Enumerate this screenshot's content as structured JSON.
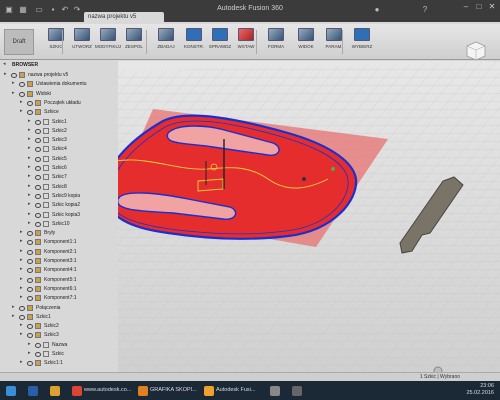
{
  "app": {
    "title": "Autodesk Fusion 360"
  },
  "doc_tab": {
    "label": "nazwa projektu v5"
  },
  "toolbar": {
    "workspace_label": "Draft",
    "tools": [
      {
        "label": "SZKIC",
        "color": "normal"
      },
      {
        "label": "UTWORZ",
        "color": "normal"
      },
      {
        "label": "MODYFIKUJ",
        "color": "normal"
      },
      {
        "label": "ZESPOL",
        "color": "normal"
      },
      {
        "label": "ZBADAJ",
        "color": "normal"
      },
      {
        "label": "KONSTR.",
        "color": "active"
      },
      {
        "label": "SPRAWDZ",
        "color": "active"
      },
      {
        "label": "WSTAW",
        "color": "red"
      },
      {
        "label": "FORMA",
        "color": "normal"
      },
      {
        "label": "WIDOK",
        "color": "normal"
      },
      {
        "label": "PARAM.",
        "color": "normal"
      },
      {
        "label": "WYBIERZ",
        "color": "active"
      }
    ]
  },
  "browser": {
    "header": "BROWSER",
    "rows": [
      {
        "label": "nazwa projektu v5",
        "indent": 0
      },
      {
        "label": "Ustawienia dokumentu",
        "indent": 1
      },
      {
        "label": "Widoki",
        "indent": 1
      },
      {
        "label": "Początek układu",
        "indent": 2
      },
      {
        "label": "Szkice",
        "indent": 2
      },
      {
        "label": "Szkic1",
        "indent": 3
      },
      {
        "label": "Szkic2",
        "indent": 3
      },
      {
        "label": "Szkic3",
        "indent": 3
      },
      {
        "label": "Szkic4",
        "indent": 3
      },
      {
        "label": "Szkic5",
        "indent": 3
      },
      {
        "label": "Szkic6",
        "indent": 3
      },
      {
        "label": "Szkic7",
        "indent": 3
      },
      {
        "label": "Szkic8",
        "indent": 3
      },
      {
        "label": "Szkic9 kopia",
        "indent": 3
      },
      {
        "label": "Szkic kopia2",
        "indent": 3
      },
      {
        "label": "Szkic kopia3",
        "indent": 3
      },
      {
        "label": "Szkic10",
        "indent": 3
      },
      {
        "label": "Bryły",
        "indent": 2
      },
      {
        "label": "Komponent1:1",
        "indent": 2
      },
      {
        "label": "Komponent2:1",
        "indent": 2
      },
      {
        "label": "Komponent3:1",
        "indent": 2
      },
      {
        "label": "Komponent4:1",
        "indent": 2
      },
      {
        "label": "Komponent5:1",
        "indent": 2
      },
      {
        "label": "Komponent6:1",
        "indent": 2
      },
      {
        "label": "Komponent7:1",
        "indent": 2
      },
      {
        "label": "Połączenia",
        "indent": 1
      },
      {
        "label": "Szkic1",
        "indent": 1
      },
      {
        "label": "Szkic2",
        "indent": 2
      },
      {
        "label": "Szkic3",
        "indent": 2
      },
      {
        "label": "Nazwa",
        "indent": 3
      },
      {
        "label": "Szkic",
        "indent": 3
      },
      {
        "label": "Szkic1:1",
        "indent": 2
      }
    ]
  },
  "statusbar": {
    "text": "1 Szkic | Wybrano"
  },
  "taskbar": {
    "items": [
      {
        "label": "",
        "color": "#3a8fd8"
      },
      {
        "label": "",
        "color": "#2c5da8"
      },
      {
        "label": "",
        "color": "#e0a030"
      },
      {
        "label": "www.autodesk.co...",
        "color": "#dd4433"
      },
      {
        "label": "GRAFIKA SKOPI...",
        "color": "#e08020"
      },
      {
        "label": "Autodesk Fusi...",
        "color": "#f0a030"
      },
      {
        "label": "",
        "color": "#888"
      },
      {
        "label": "",
        "color": "#666"
      }
    ],
    "time": "23:06",
    "date": "25.02.2016"
  }
}
